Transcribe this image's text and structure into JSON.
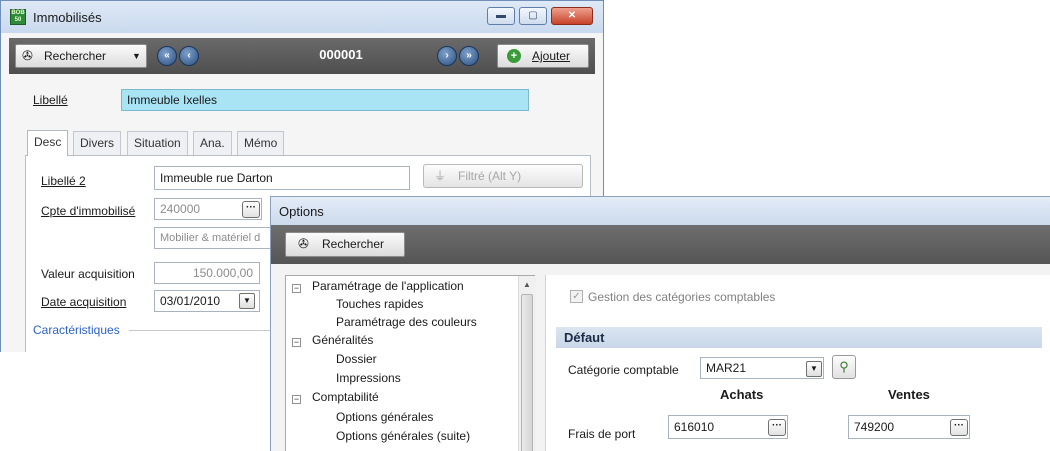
{
  "window1": {
    "title": "Immobilisés",
    "toolbar": {
      "search_label": "Rechercher",
      "record_code": "000001",
      "add_label": "Ajouter"
    },
    "libelle_label": "Libellé",
    "libelle_value": "Immeuble Ixelles",
    "tabs": [
      "Desc",
      "Divers",
      "Situation",
      "Ana.",
      "Mémo"
    ],
    "form": {
      "libelle2_label": "Libellé 2",
      "libelle2_value": "Immeuble rue Darton",
      "filter_label": "Filtré (Alt Y)",
      "account_label": "Cpte d'immobilisé",
      "account_value": "240000",
      "account_desc": "Mobilier & matériel d",
      "acq_value_label": "Valeur acquisition",
      "acq_value": "150.000,00",
      "acq_date_label": "Date acquisition",
      "acq_date": "03/01/2010",
      "characteristics_label": "Caractéristiques"
    }
  },
  "window2": {
    "title": "Options",
    "toolbar": {
      "search_label": "Rechercher"
    },
    "tree": [
      {
        "label": "Paramétrage de l'application",
        "level": 0,
        "expanded": true
      },
      {
        "label": "Touches rapides",
        "level": 1
      },
      {
        "label": "Paramétrage des couleurs",
        "level": 1
      },
      {
        "label": "Généralités",
        "level": 0,
        "expanded": true
      },
      {
        "label": "Dossier",
        "level": 1
      },
      {
        "label": "Impressions",
        "level": 1
      },
      {
        "label": "Comptabilité",
        "level": 0,
        "expanded": true
      },
      {
        "label": "Options générales",
        "level": 1
      },
      {
        "label": "Options générales (suite)",
        "level": 1
      }
    ],
    "panel": {
      "manage_categories_label": "Gestion des catégories comptables",
      "manage_categories_checked": true,
      "section_title": "Défaut",
      "category_label": "Catégorie comptable",
      "category_value": "MAR21",
      "col_achats": "Achats",
      "col_ventes": "Ventes",
      "frais_label": "Frais de port",
      "frais_achats": "616010",
      "frais_ventes": "749200"
    }
  },
  "colors": {
    "toolbar": "#5a5a5a",
    "libelle_highlight": "#a8e4f4",
    "link_blue": "#2a62c9"
  }
}
